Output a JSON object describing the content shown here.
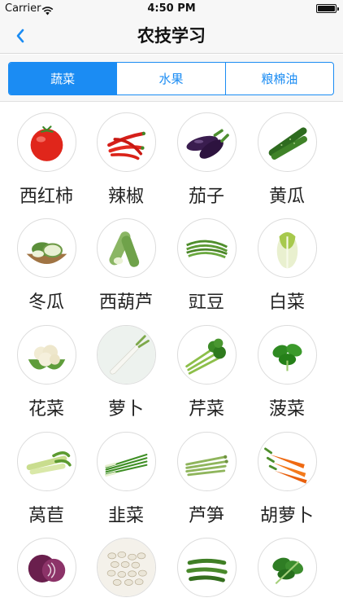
{
  "status": {
    "carrier": "Carrier",
    "time": "4:50 PM"
  },
  "nav": {
    "title": "农技学习"
  },
  "tabs": [
    {
      "label": "蔬菜",
      "active": true
    },
    {
      "label": "水果",
      "active": false
    },
    {
      "label": "粮棉油",
      "active": false
    }
  ],
  "items": [
    {
      "name": "西红柿",
      "icon": "tomato-icon"
    },
    {
      "name": "辣椒",
      "icon": "chili-pepper-icon"
    },
    {
      "name": "茄子",
      "icon": "eggplant-icon"
    },
    {
      "name": "黄瓜",
      "icon": "cucumber-icon"
    },
    {
      "name": "冬瓜",
      "icon": "winter-melon-icon"
    },
    {
      "name": "西葫芦",
      "icon": "zucchini-icon"
    },
    {
      "name": "豇豆",
      "icon": "long-bean-icon"
    },
    {
      "name": "白菜",
      "icon": "napa-cabbage-icon"
    },
    {
      "name": "花菜",
      "icon": "cauliflower-icon"
    },
    {
      "name": "萝卜",
      "icon": "radish-icon"
    },
    {
      "name": "芹菜",
      "icon": "celery-icon"
    },
    {
      "name": "菠菜",
      "icon": "spinach-icon"
    },
    {
      "name": "莴苣",
      "icon": "lettuce-stem-icon"
    },
    {
      "name": "韭菜",
      "icon": "chives-icon"
    },
    {
      "name": "芦笋",
      "icon": "asparagus-icon"
    },
    {
      "name": "胡萝卜",
      "icon": "carrot-icon"
    },
    {
      "name": "",
      "icon": "red-cabbage-icon"
    },
    {
      "name": "",
      "icon": "white-beans-icon"
    },
    {
      "name": "",
      "icon": "green-beans-icon"
    },
    {
      "name": "",
      "icon": "leafy-greens-icon"
    }
  ],
  "colors": {
    "accent": "#1b8cf3"
  }
}
